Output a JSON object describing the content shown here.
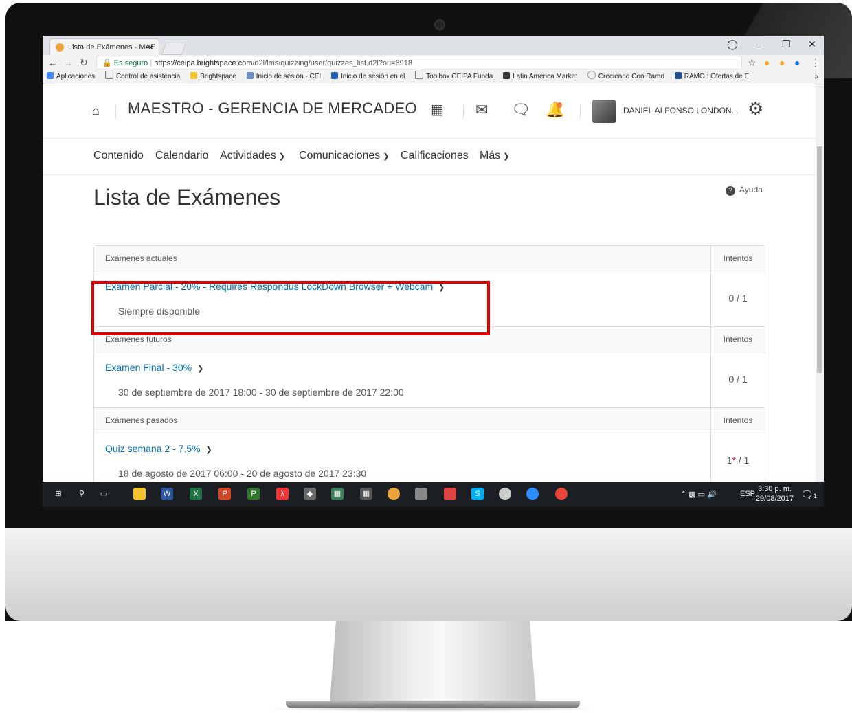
{
  "browser": {
    "tab_title": "Lista de Exámenes - MAE",
    "tab_close": "×",
    "secure_label": "Es seguro",
    "url_host": "https://ceipa.brightspace.com",
    "url_path": "/d2l/lms/quizzing/user/quizzes_list.d2l?ou=6918",
    "bookmarks": [
      "Aplicaciones",
      "Control de asistencia",
      "Brightspace",
      "Inicio de sesión - CEI",
      "Inicio de sesión en el",
      "Toolbox CEIPA Funda",
      "Latin America Market",
      "Creciendo Con Ramo",
      "RAMO : Ofertas de E"
    ],
    "bookmarks_more": "»"
  },
  "header": {
    "course_name": "MAESTRO - GERENCIA DE MERCADEO",
    "user_name": "DANIEL ALFONSO LONDON..."
  },
  "menu": {
    "items": [
      "Contenido",
      "Calendario",
      "Actividades",
      "Comunicaciones",
      "Calificaciones",
      "Más"
    ]
  },
  "page": {
    "title": "Lista de Exámenes",
    "help": "Ayuda"
  },
  "sections": [
    {
      "heading": "Exámenes actuales",
      "attempts_heading": "Intentos",
      "quiz_title": "Examen Parcial - 20% - Requires Respondus LockDown Browser + Webcam",
      "availability": "Siempre disponible",
      "attempts": "0 / 1"
    },
    {
      "heading": "Exámenes futuros",
      "attempts_heading": "Intentos",
      "quiz_title": "Examen Final - 30%",
      "availability": "30 de septiembre de 2017 18:00 - 30 de septiembre de 2017 22:00",
      "attempts": "0 / 1"
    },
    {
      "heading": "Exámenes pasados",
      "attempts_heading": "Intentos",
      "quiz_title": "Quiz semana 2 - 7.5%",
      "availability": "18 de agosto de 2017 06:00 - 20 de agosto de 2017 23:30",
      "attempts_count": "1",
      "attempts_star": "*",
      "attempts_total": "/ 1"
    }
  ],
  "taskbar": {
    "language": "ESP",
    "time": "3:30 p. m.",
    "date": "29/08/2017",
    "notifications": "1"
  },
  "colors": {
    "link": "#006fbf",
    "highlight_border": "#e00000",
    "notification_dot": "#f27b36"
  }
}
